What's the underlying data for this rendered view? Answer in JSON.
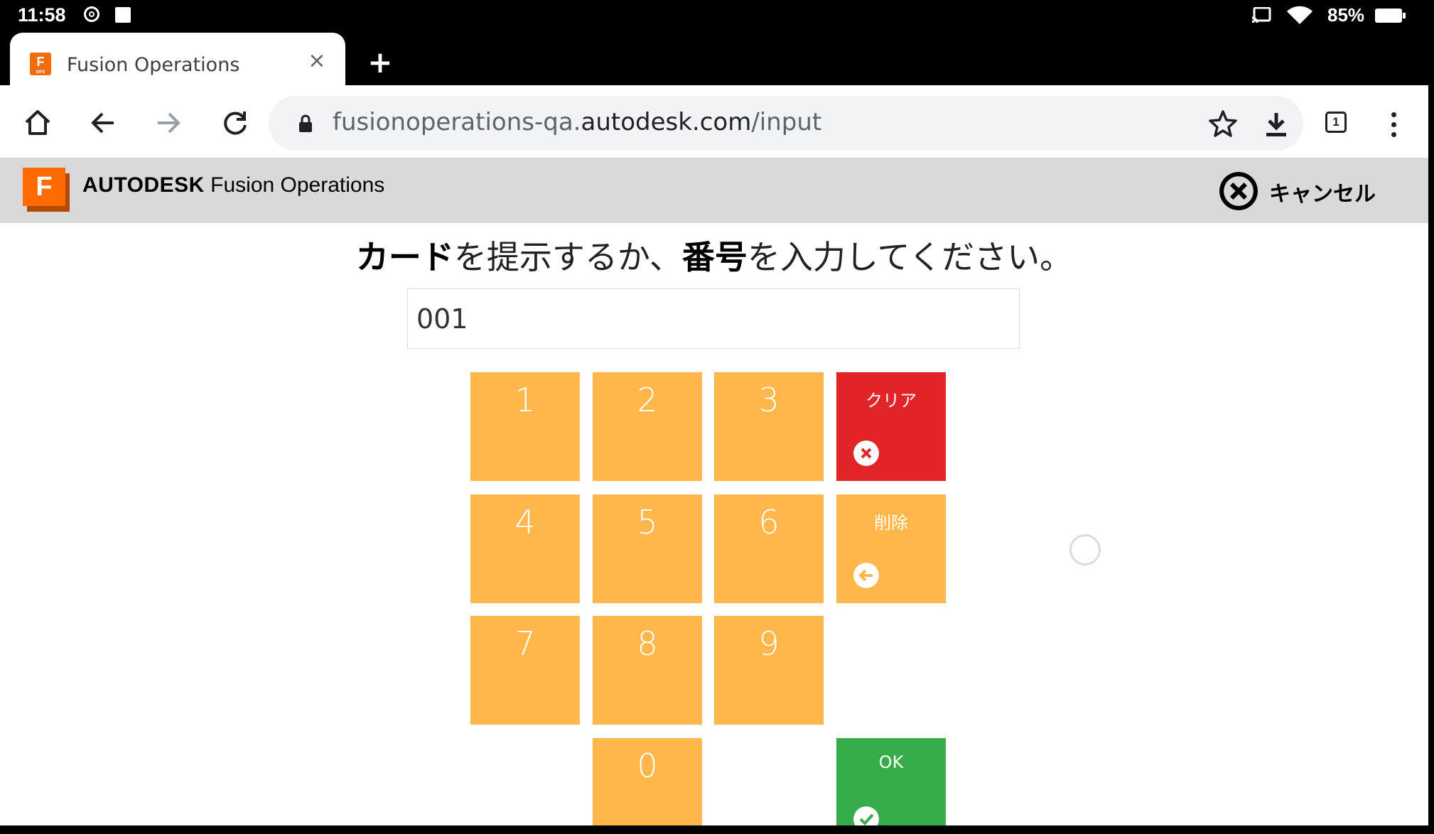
{
  "status_bar": {
    "time": "11:58",
    "battery": "85%"
  },
  "browser": {
    "tab": {
      "title": "Fusion Operations",
      "close": "×",
      "new_tab": "+"
    },
    "omnibox": {
      "url_prefix": "fusionoperations-qa.",
      "url_host": "autodesk.com",
      "url_path": "/input"
    },
    "tab_count": "1"
  },
  "app_header": {
    "logo_letter": "F",
    "brand_bold": "AUTODESK",
    "brand_rest": " Fusion Operations",
    "cancel_label": "キャンセル"
  },
  "main": {
    "prompt": {
      "part1_bold": "カード",
      "part2": "を提示するか、",
      "part3_bold": "番号",
      "part4": "を入力してください。"
    },
    "input_value": "001",
    "keypad": {
      "digits": [
        "1",
        "2",
        "3",
        "4",
        "5",
        "6",
        "7",
        "8",
        "9",
        "0"
      ],
      "clear_label": "クリア",
      "delete_label": "削除",
      "ok_label": "OK"
    }
  },
  "colors": {
    "key_orange": "#ffb74b",
    "clear_red": "#e12428",
    "ok_green": "#37ac4a",
    "header_gray": "#d9d9d9",
    "brand_orange": "#ff6b00"
  },
  "icons": {
    "home": "home-icon",
    "back": "arrow-left-icon",
    "forward": "arrow-right-icon",
    "reload": "reload-icon",
    "lock": "lock-icon",
    "bookmark": "star-icon",
    "download": "download-icon",
    "menu": "kebab-menu-icon",
    "cancel": "close-circle-icon",
    "clear": "x-circle-icon",
    "delete": "arrow-left-circle-icon",
    "ok": "check-circle-icon"
  }
}
